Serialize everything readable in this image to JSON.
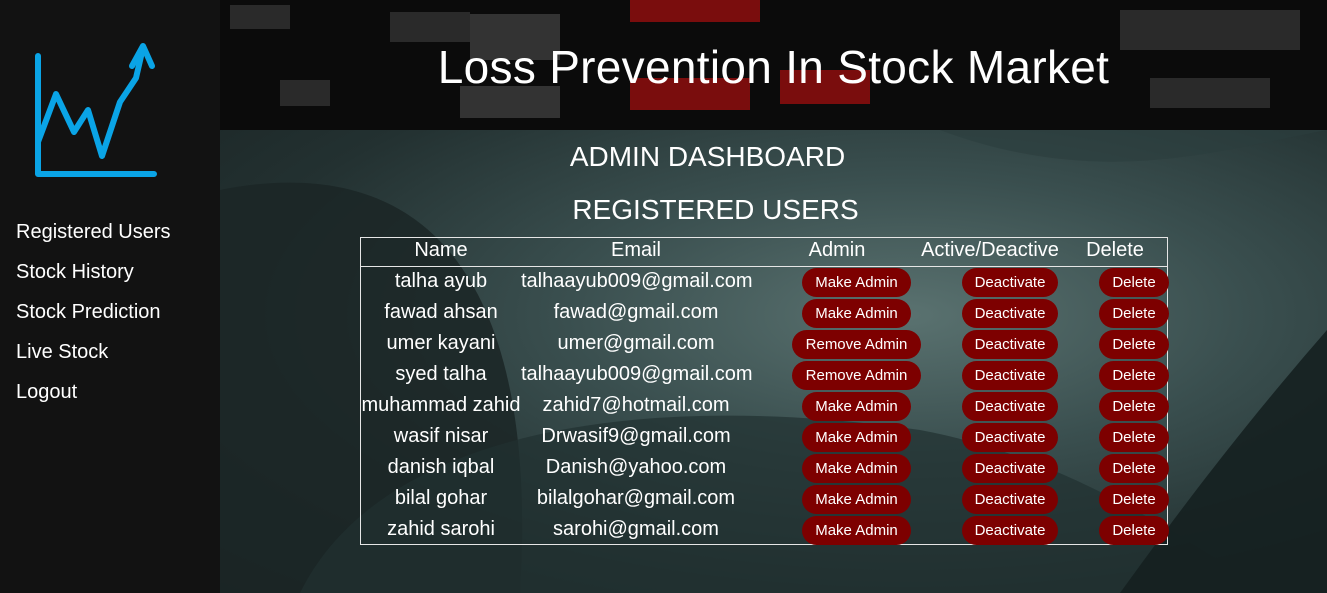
{
  "header": {
    "title": "Loss Prevention In Stock Market"
  },
  "sidebar": {
    "logo": "stock-chart-logo-icon",
    "items": [
      {
        "label": "Registered Users"
      },
      {
        "label": "Stock History"
      },
      {
        "label": "Stock Prediction"
      },
      {
        "label": "Live Stock"
      },
      {
        "label": "Logout"
      }
    ]
  },
  "main": {
    "dashboard_title": "ADMIN DASHBOARD",
    "section_title": "REGISTERED USERS",
    "table": {
      "columns": [
        "Name",
        "Email",
        "Admin",
        "Active/Deactive",
        "Delete"
      ],
      "rows": [
        {
          "name": "talha ayub",
          "email": "talhaayub009@gmail.com",
          "admin_action": "Make Admin",
          "status_action": "Deactivate",
          "delete_action": "Delete"
        },
        {
          "name": "fawad ahsan",
          "email": "fawad@gmail.com",
          "admin_action": "Make Admin",
          "status_action": "Deactivate",
          "delete_action": "Delete"
        },
        {
          "name": "umer kayani",
          "email": "umer@gmail.com",
          "admin_action": "Remove Admin",
          "status_action": "Deactivate",
          "delete_action": "Delete"
        },
        {
          "name": "syed talha",
          "email": "talhaayub009@gmail.com",
          "admin_action": "Remove Admin",
          "status_action": "Deactivate",
          "delete_action": "Delete"
        },
        {
          "name": "muhammad zahid",
          "email": "zahid7@hotmail.com",
          "admin_action": "Make Admin",
          "status_action": "Deactivate",
          "delete_action": "Delete"
        },
        {
          "name": "wasif nisar",
          "email": "Drwasif9@gmail.com",
          "admin_action": "Make Admin",
          "status_action": "Deactivate",
          "delete_action": "Delete"
        },
        {
          "name": "danish iqbal",
          "email": "Danish@yahoo.com",
          "admin_action": "Make Admin",
          "status_action": "Deactivate",
          "delete_action": "Delete"
        },
        {
          "name": "bilal gohar",
          "email": "bilalgohar@gmail.com",
          "admin_action": "Make Admin",
          "status_action": "Deactivate",
          "delete_action": "Delete"
        },
        {
          "name": "zahid sarohi",
          "email": "sarohi@gmail.com",
          "admin_action": "Make Admin",
          "status_action": "Deactivate",
          "delete_action": "Delete"
        }
      ]
    }
  },
  "colors": {
    "sidebar_bg": "#121212",
    "logo_accent": "#0aa4e6",
    "button_bg": "#7d0000",
    "text": "#ffffff"
  }
}
